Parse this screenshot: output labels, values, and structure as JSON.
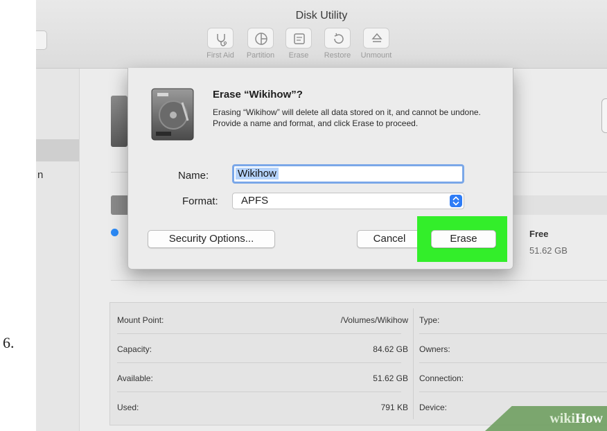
{
  "step_number": "6.",
  "window": {
    "title": "Disk Utility"
  },
  "toolbar": {
    "buttons": [
      {
        "label": "First Aid",
        "icon": "stethoscope-icon"
      },
      {
        "label": "Partition",
        "icon": "pie-icon"
      },
      {
        "label": "Erase",
        "icon": "eraser-icon"
      },
      {
        "label": "Restore",
        "icon": "restore-icon"
      },
      {
        "label": "Unmount",
        "icon": "eject-icon"
      }
    ]
  },
  "sidebar": {
    "fragment": "n"
  },
  "dialog": {
    "title": "Erase “Wikihow”?",
    "message": "Erasing “Wikihow” will delete all data stored on it, and cannot be undone. Provide a name and format, and click Erase to proceed.",
    "name_label": "Name:",
    "name_value": "Wikihow",
    "format_label": "Format:",
    "format_value": "APFS",
    "security_button": "Security Options...",
    "cancel_button": "Cancel",
    "erase_button": "Erase",
    "highlight_color": "#33ee2a"
  },
  "storage": {
    "free_label": "Free",
    "free_value": "51.62 GB",
    "used_color": "#2b8af7"
  },
  "info": {
    "rows": [
      {
        "key": "Mount Point:",
        "value": "/Volumes/Wikihow",
        "key2": "Type:"
      },
      {
        "key": "Capacity:",
        "value": "84.62 GB",
        "key2": "Owners:"
      },
      {
        "key": "Available:",
        "value": "51.62 GB",
        "key2": "Connection:"
      },
      {
        "key": "Used:",
        "value": "791 KB",
        "key2": "Device:"
      }
    ]
  },
  "watermark": {
    "part1": "wiki",
    "part2": "How"
  }
}
